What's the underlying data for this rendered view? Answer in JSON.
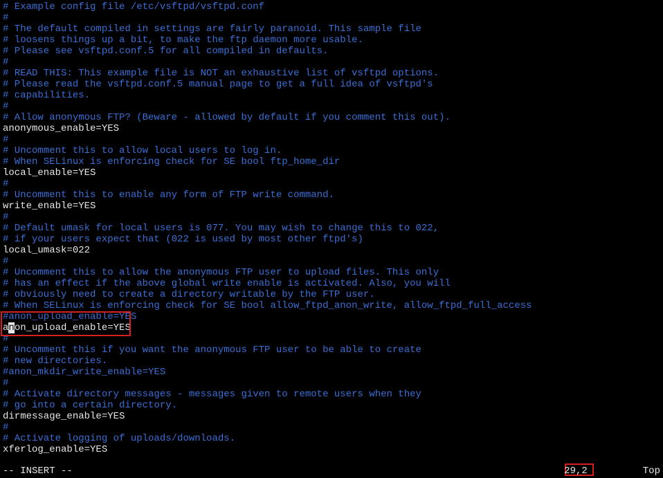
{
  "lines": [
    {
      "cls": "comment",
      "text": "# Example config file /etc/vsftpd/vsftpd.conf"
    },
    {
      "cls": "comment",
      "text": "#"
    },
    {
      "cls": "comment",
      "text": "# The default compiled in settings are fairly paranoid. This sample file"
    },
    {
      "cls": "comment",
      "text": "# loosens things up a bit, to make the ftp daemon more usable."
    },
    {
      "cls": "comment",
      "text": "# Please see vsftpd.conf.5 for all compiled in defaults."
    },
    {
      "cls": "comment",
      "text": "#"
    },
    {
      "cls": "comment",
      "text": "# READ THIS: This example file is NOT an exhaustive list of vsftpd options."
    },
    {
      "cls": "comment",
      "text": "# Please read the vsftpd.conf.5 manual page to get a full idea of vsftpd's"
    },
    {
      "cls": "comment",
      "text": "# capabilities."
    },
    {
      "cls": "comment",
      "text": "#"
    },
    {
      "cls": "comment",
      "text": "# Allow anonymous FTP? (Beware - allowed by default if you comment this out)."
    },
    {
      "cls": "setting",
      "text": "anonymous_enable=YES"
    },
    {
      "cls": "comment",
      "text": "#"
    },
    {
      "cls": "comment",
      "text": "# Uncomment this to allow local users to log in."
    },
    {
      "cls": "comment",
      "text": "# When SELinux is enforcing check for SE bool ftp_home_dir"
    },
    {
      "cls": "setting",
      "text": "local_enable=YES"
    },
    {
      "cls": "comment",
      "text": "#"
    },
    {
      "cls": "comment",
      "text": "# Uncomment this to enable any form of FTP write command."
    },
    {
      "cls": "setting",
      "text": "write_enable=YES"
    },
    {
      "cls": "comment",
      "text": "#"
    },
    {
      "cls": "comment",
      "text": "# Default umask for local users is 077. You may wish to change this to 022,"
    },
    {
      "cls": "comment",
      "text": "# if your users expect that (022 is used by most other ftpd's)"
    },
    {
      "cls": "setting",
      "text": "local_umask=022"
    },
    {
      "cls": "comment",
      "text": "#"
    },
    {
      "cls": "comment",
      "text": "# Uncomment this to allow the anonymous FTP user to upload files. This only"
    },
    {
      "cls": "comment",
      "text": "# has an effect if the above global write enable is activated. Also, you will"
    },
    {
      "cls": "comment",
      "text": "# obviously need to create a directory writable by the FTP user."
    },
    {
      "cls": "comment",
      "text": "# When SELinux is enforcing check for SE bool allow_ftpd_anon_write, allow_ftpd_full_access"
    },
    {
      "cls": "comment",
      "text": "#anon_upload_enable=YES"
    },
    {
      "cls": "setting",
      "text": "anon_upload_enable=YES",
      "cursor": true
    },
    {
      "cls": "comment",
      "text": "#"
    },
    {
      "cls": "comment",
      "text": "# Uncomment this if you want the anonymous FTP user to be able to create"
    },
    {
      "cls": "comment",
      "text": "# new directories."
    },
    {
      "cls": "comment",
      "text": "#anon_mkdir_write_enable=YES"
    },
    {
      "cls": "comment",
      "text": "#"
    },
    {
      "cls": "comment",
      "text": "# Activate directory messages - messages given to remote users when they"
    },
    {
      "cls": "comment",
      "text": "# go into a certain directory."
    },
    {
      "cls": "setting",
      "text": "dirmessage_enable=YES"
    },
    {
      "cls": "comment",
      "text": "#"
    },
    {
      "cls": "comment",
      "text": "# Activate logging of uploads/downloads."
    },
    {
      "cls": "setting",
      "text": "xferlog_enable=YES"
    }
  ],
  "status": {
    "mode": "-- INSERT --",
    "position": "29,2",
    "scroll": "Top"
  }
}
